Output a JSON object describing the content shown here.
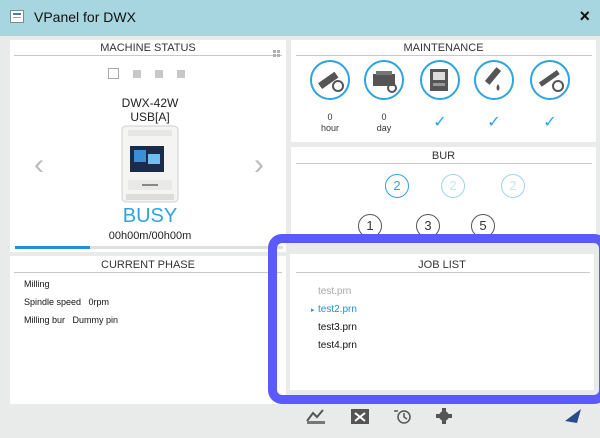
{
  "window": {
    "title": "VPanel for DWX",
    "close_glyph": "×"
  },
  "machine_status": {
    "title": "MACHINE STATUS",
    "model": "DWX-42W",
    "port": "USB[A]",
    "state": "BUSY",
    "time": "00h00m/00h00m",
    "progress_fraction": 0.28,
    "prev_glyph": "‹",
    "next_glyph": "›"
  },
  "maintenance": {
    "title": "MAINTENANCE",
    "items": [
      {
        "icon": "spindle-hours-icon",
        "value": "0",
        "unit": "hour"
      },
      {
        "icon": "machine-days-icon",
        "value": "0",
        "unit": "day"
      },
      {
        "icon": "dust-collector-icon",
        "check": "✓"
      },
      {
        "icon": "cleaning-brush-icon",
        "check": "✓"
      },
      {
        "icon": "air-blow-icon",
        "check": "✓"
      }
    ]
  },
  "bur": {
    "title": "BUR",
    "row1": [
      "2",
      "2",
      "2"
    ],
    "row2": [
      "1",
      "3",
      "5"
    ]
  },
  "current_phase": {
    "title": "CURRENT PHASE",
    "lines": [
      "Milling",
      "Spindle speed   0rpm",
      "Milling bur   Dummy pin"
    ]
  },
  "job_list": {
    "title": "JOB LIST",
    "jobs": [
      "test.prn",
      "test2.prn",
      "test3.prn",
      "test4.prn"
    ],
    "current_marker": "▸"
  },
  "colors": {
    "accent": "#2ca4e0",
    "highlight": "#5a5aff",
    "titlebar": "#a8d6e0"
  }
}
